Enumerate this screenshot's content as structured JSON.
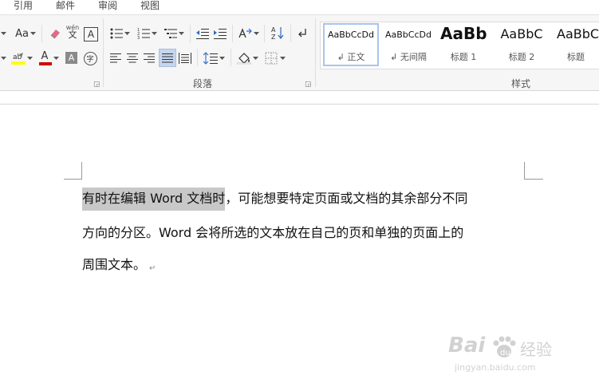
{
  "tabs": [
    "引用",
    "邮件",
    "审阅",
    "视图"
  ],
  "ribbon": {
    "font_aa_label": "Aa",
    "phonetic_top": "wén",
    "phonetic_bottom": "文",
    "char_border": "A",
    "enclose_char": "字",
    "font_color_letter": "A",
    "shading_letter": "A",
    "sort_label": "A↓Z",
    "paragraph_group_label": "段落",
    "styles_group_label": "样式"
  },
  "styles": [
    {
      "preview": "AaBbCcDd",
      "name": "↲ 正文",
      "selected": true
    },
    {
      "preview": "AaBbCcDd",
      "name": "↲ 无间隔",
      "selected": false
    },
    {
      "preview": "AaBb",
      "name": "标题 1",
      "selected": false
    },
    {
      "preview": "AaBbC",
      "name": "标题 2",
      "selected": false
    },
    {
      "preview": "AaBbC",
      "name": "标题",
      "selected": false
    }
  ],
  "document": {
    "line1_selected": "有时在编辑 Word 文档时",
    "line1_rest": "，可能想要特定页面或文档的其余部分不同",
    "line2": "方向的分区。Word 会将所选的文本放在自己的页和单独的页面上的",
    "line3": "周围文本。",
    "paragraph_mark": "↵"
  },
  "watermark": {
    "brand": "Bai",
    "brand_cn": "经验",
    "url": "jingyan.baidu.com"
  },
  "colors": {
    "highlight": "#ffff00",
    "font_color": "#d00000",
    "selection": "#c8c8c8",
    "style_selected_border": "#a9c5eb"
  }
}
